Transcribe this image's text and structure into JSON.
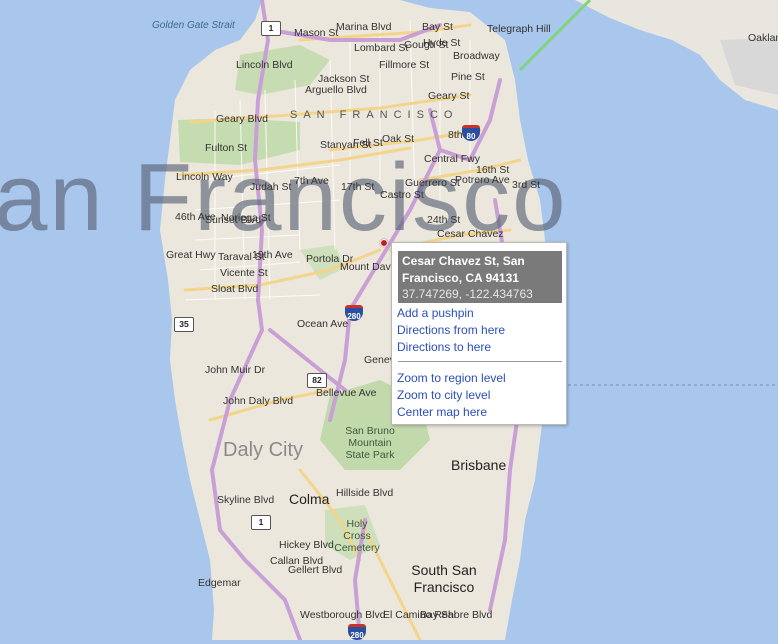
{
  "map": {
    "big_label": "an Francisco",
    "water_labels": [
      "Golden Gate Strait"
    ],
    "district_label": "SAN FRANCISCO",
    "city_labels": [
      "Daly City"
    ],
    "town_labels": [
      "Colma",
      "Brisbane",
      "South San Francisco",
      "Edgemar"
    ],
    "park_labels": [
      "San Bruno Mountain State Park",
      "Holy Cross Cemetery",
      "Mount Davidson"
    ],
    "landmark_labels": [
      "Telegraph Hill",
      "Broadway",
      "Oakland"
    ],
    "street_labels": [
      "Bay St",
      "Marina Blvd",
      "Mason St",
      "Lombard St",
      "Hyde St",
      "Jackson St",
      "Fillmore St",
      "Gough St",
      "Pine St",
      "Arguello Blvd",
      "Geary St",
      "Geary Blvd",
      "Lincoln Blvd",
      "Fulton St",
      "Fell St",
      "Oak St",
      "Stanyan St",
      "Central Fwy",
      "8th St",
      "16th St",
      "Potrero Ave",
      "3rd St",
      "Lincoln Way",
      "Judah St",
      "7th Ave",
      "17th St",
      "Castro St",
      "Guerrero St",
      "24th St",
      "Cesar Chavez",
      "Noriega St",
      "46th Ave",
      "Sunset Blvd",
      "Taraval St",
      "Vicente St",
      "19th Ave",
      "Great Hwy",
      "Sloat Blvd",
      "Portola Dr",
      "Ocean Ave",
      "John Muir Dr",
      "Geneva Ave",
      "John Daly Blvd",
      "Bellevue Ave",
      "Skyline Blvd",
      "Hillside Blvd",
      "Hickey Blvd",
      "Callan Blvd",
      "Gellert Blvd",
      "Westborough Blvd",
      "El Camino Real",
      "Bay Shore Blvd"
    ],
    "shields": [
      "1",
      "80",
      "35",
      "280",
      "82",
      "1",
      "280"
    ],
    "pushpin": {
      "color": "#c0201b"
    }
  },
  "popup": {
    "title": "Cesar Chavez St, San Francisco, CA 94131",
    "coords": "37.747269, -122.434763",
    "links_top": [
      "Add a pushpin",
      "Directions from here",
      "Directions to here"
    ],
    "links_bottom": [
      "Zoom to region level",
      "Zoom to city level",
      "Center map here"
    ]
  },
  "colors": {
    "water": "#a9c7ec",
    "land": "#ece7dc",
    "park": "#c5dbb0",
    "major_road": "#f3d48b",
    "freeway": "#c9a0d6",
    "link": "#2a4fb8",
    "popup_header": "#7a7a7a"
  }
}
